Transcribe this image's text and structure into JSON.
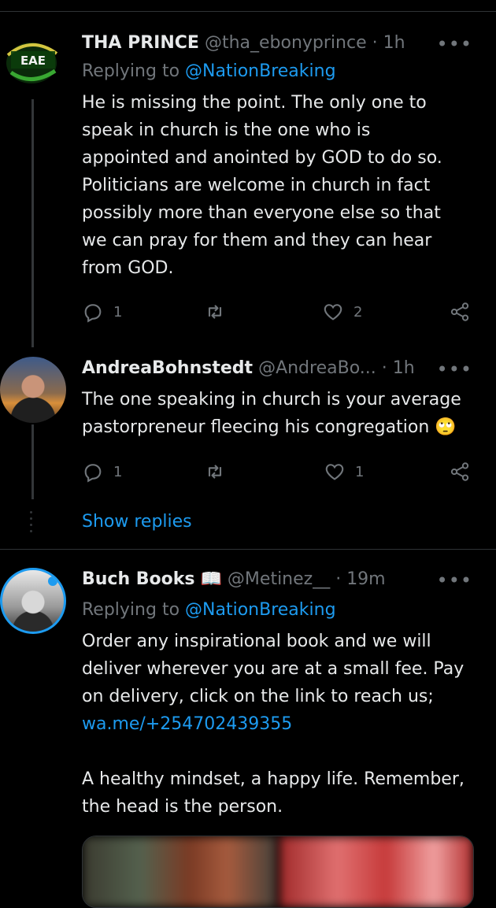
{
  "tweets": [
    {
      "name": "THA PRINCE",
      "handle": "@tha_ebonyprince",
      "time": "· 1h",
      "replying_prefix": "Replying to",
      "replying_to": "@NationBreaking",
      "lines": [
        "He is missing the point. The only one to",
        "speak in church is the one who is",
        "appointed and anointed by GOD to do so.",
        "Politicians are welcome in church in fact",
        "possibly more than everyone else so that",
        "we can pray for them and they can hear",
        "from GOD."
      ],
      "avatar_text": "EAE",
      "replies": "1",
      "retweets": "",
      "likes": "2"
    },
    {
      "name": "AndreaBohnstedt",
      "handle": "@AndreaBo...",
      "time": "· 1h",
      "lines": [
        "The one speaking in church is your average",
        "pastorpreneur fleecing his congregation"
      ],
      "emoji": "🙄",
      "replies": "1",
      "retweets": "",
      "likes": "1"
    },
    {
      "name": "Buch Books",
      "name_emoji": "📖",
      "handle": "@Metinez__",
      "time": "· 19m",
      "replying_prefix": "Replying to",
      "replying_to": "@NationBreaking",
      "lines": [
        "Order any inspirational book and we will",
        "deliver wherever you are at a small fee. Pay",
        "on delivery, click on the link to reach us;"
      ],
      "link": "wa.me/+254702439355",
      "lines2": [
        "A healthy mindset, a happy life. Remember,",
        "the head is the person."
      ]
    }
  ],
  "more_label": "•••",
  "show_replies": "Show replies",
  "icons": {
    "reply": "reply-icon",
    "retweet": "retweet-icon",
    "like": "heart-icon",
    "share": "share-icon",
    "more": "more-icon"
  },
  "colors": {
    "background": "#000000",
    "text": "#e7e9ea",
    "secondary": "#71767b",
    "accent": "#1d9bf0",
    "divider": "#2f3336"
  }
}
